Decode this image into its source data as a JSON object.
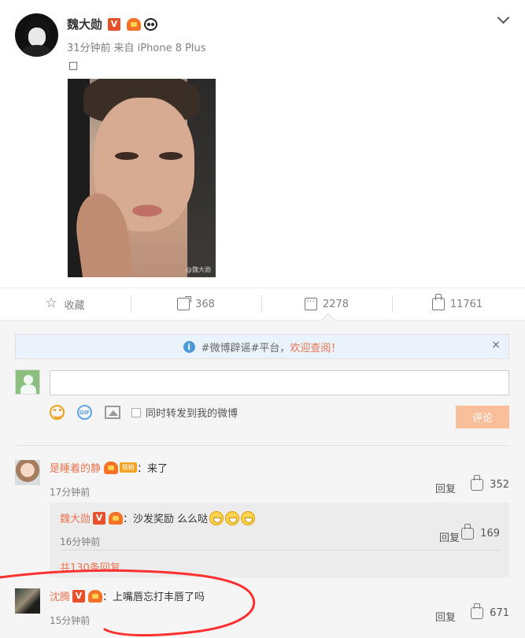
{
  "post": {
    "author": "魏大勋",
    "meta_time": "31分钟前",
    "meta_source": "来自 iPhone 8 Plus",
    "text": "□",
    "photo_watermark": "@魏大勋"
  },
  "actions": {
    "favorite_label": "收藏",
    "share_count": "368",
    "comment_count": "2278",
    "like_count": "11761"
  },
  "notice": {
    "prefix": "#微博辟谣#平台，",
    "link_text": "欢迎查阅！",
    "close": "×"
  },
  "compose": {
    "repost_label": "同时转发到我的微博",
    "submit_label": "评论",
    "gif_label": "GIF"
  },
  "comments": [
    {
      "username": "是睡着的静",
      "badge_text": "铁粉",
      "text": "：来了",
      "time": "17分钟前",
      "reply_label": "回复",
      "likes": "352"
    },
    {
      "username": "沈腾",
      "text": "：上嘴唇忘打丰唇了吗",
      "time": "15分钟前",
      "reply_label": "回复",
      "likes": "671"
    }
  ],
  "reply": {
    "username": "魏大勋",
    "text": "：沙发奖励 么么哒",
    "time": "16分钟前",
    "reply_label": "回复",
    "likes": "169",
    "more_label": "共130条回复"
  },
  "colors": {
    "accent": "#eb7350",
    "notice_bg": "#eaf3fb",
    "annotation": "#ff3030"
  }
}
